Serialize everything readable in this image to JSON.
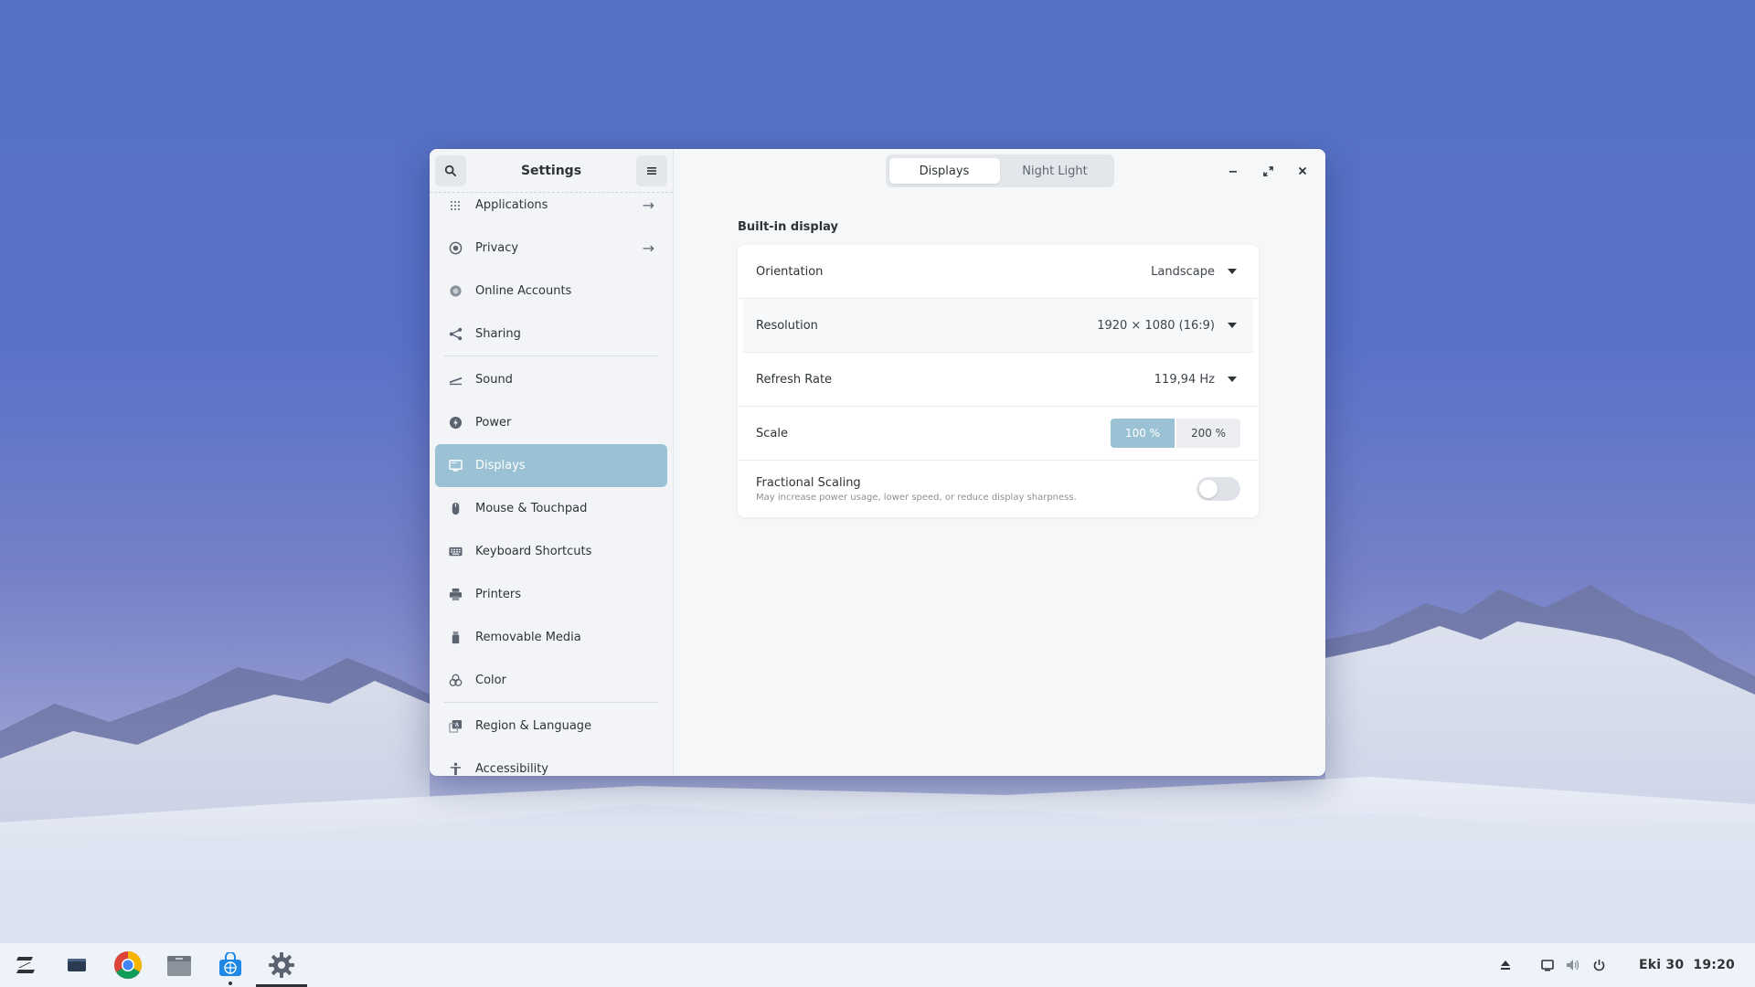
{
  "window": {
    "title": "Settings",
    "tabs": [
      {
        "label": "Displays",
        "active": true
      },
      {
        "label": "Night Light",
        "active": false
      }
    ]
  },
  "sidebar": {
    "items": [
      {
        "label": "Applications",
        "icon": "apps-grid-icon",
        "arrow": true
      },
      {
        "label": "Privacy",
        "icon": "privacy-icon",
        "arrow": true
      },
      {
        "label": "Online Accounts",
        "icon": "online-accounts-icon",
        "arrow": false
      },
      {
        "label": "Sharing",
        "icon": "share-icon",
        "arrow": false
      },
      {
        "label": "Sound",
        "icon": "sound-icon",
        "arrow": false
      },
      {
        "label": "Power",
        "icon": "power-icon",
        "arrow": false
      },
      {
        "label": "Displays",
        "icon": "display-icon",
        "arrow": false,
        "active": true
      },
      {
        "label": "Mouse & Touchpad",
        "icon": "mouse-icon",
        "arrow": false
      },
      {
        "label": "Keyboard Shortcuts",
        "icon": "keyboard-icon",
        "arrow": false
      },
      {
        "label": "Printers",
        "icon": "printer-icon",
        "arrow": false
      },
      {
        "label": "Removable Media",
        "icon": "usb-icon",
        "arrow": false
      },
      {
        "label": "Color",
        "icon": "color-icon",
        "arrow": false
      },
      {
        "label": "Region & Language",
        "icon": "language-icon",
        "arrow": false
      },
      {
        "label": "Accessibility",
        "icon": "accessibility-icon",
        "arrow": false
      }
    ]
  },
  "display": {
    "section_title": "Built-in display",
    "orientation": {
      "label": "Orientation",
      "value": "Landscape"
    },
    "resolution": {
      "label": "Resolution",
      "value": "1920 × 1080 (16:9)"
    },
    "refresh_rate": {
      "label": "Refresh Rate",
      "value": "119,94 Hz"
    },
    "scale": {
      "label": "Scale",
      "options": [
        "100 %",
        "200 %"
      ],
      "selected": "100 %"
    },
    "fractional_scaling": {
      "label": "Fractional Scaling",
      "description": "May increase power usage, lower speed, or reduce display sharpness.",
      "enabled": false
    }
  },
  "taskbar": {
    "apps": [
      "zorin-menu-icon",
      "workspaces-icon",
      "chrome-icon",
      "files-icon",
      "software-store-icon",
      "settings-gear-icon"
    ],
    "date": "Eki 30",
    "time": "19:20"
  },
  "colors": {
    "accent": "#9bc2d4",
    "sky_top": "#5472c4"
  }
}
